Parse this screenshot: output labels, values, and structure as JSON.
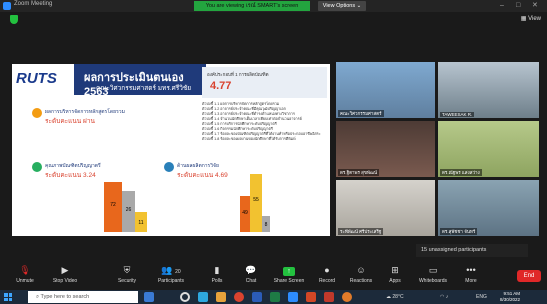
{
  "window": {
    "title": "Zoom Meeting",
    "share_banner": "You are viewing เรณ์ SMART's screen",
    "view_options": "View Options",
    "view_label": "View",
    "controls": [
      "–",
      "□",
      "✕"
    ]
  },
  "slide": {
    "logo": "RUTS",
    "title": "ผลการประเมินตนเอง 2563",
    "subtitle": "คณะวิศวกรรมศาสตร์ มทร.ศรีวิชัย",
    "score_heading": "องค์ประกอบที่ 1 การผลิตบัณฑิต",
    "score_value": "4.77",
    "criteria": [
      "ตัวบ่งชี้ 1.1  ผลการบริหารจัดการหลักสูตรโดยรวม",
      "ตัวบ่งชี้ 1.2  อาจารย์ประจำคณะที่มีคุณวุฒิปริญญาเอก",
      "ตัวบ่งชี้ 1.3  อาจารย์ประจำคณะที่ดำรงตำแหน่งทางวิชาการ",
      "ตัวบ่งชี้ 1.4  จำนวนนักศึกษาเต็มเวลาเทียบเท่าต่อจำนวนอาจารย์",
      "ตัวบ่งชี้ 1.5  การบริการนักศึกษาระดับปริญญาตรี",
      "ตัวบ่งชี้ 1.6  กิจกรรมนักศึกษาระดับปริญญาตรี",
      "ตัวบ่งชี้ 1.7  ร้อยละของบัณฑิตปริญญาตรีที่ได้งานทำหรือประกอบอาชีพอิสระ",
      "ตัวบ่งชี้ 1.8  ร้อยละของผลงานของนักศึกษาที่ได้รับการตีพิมพ์"
    ],
    "section1_label": "ผลการบริหารจัดการหลักสูตรโดยรวม",
    "section1_value": "ระดับคะแนน ผ่าน",
    "section2_label": "คุณภาพบัณฑิตปริญญาตรี",
    "section2_value": "ระดับคะแนน 3.24",
    "section3_label": "ด้านผลผลิตการวิจัย",
    "section3_value": "ระดับคะแนน 4.69",
    "chart_a_values": [
      "72",
      "26",
      "11"
    ],
    "chart_b_values": [
      "55",
      "49",
      "8"
    ]
  },
  "participants": [
    {
      "name": "คณะวิศวกรรมศาสตร์"
    },
    {
      "name": "TAWEESAK R."
    },
    {
      "name": "ดร.ฐิตาพร สุขพัฒน์"
    },
    {
      "name": "ดร.ณัฐพร แสงสว่าง"
    },
    {
      "name": "Suttisak"
    },
    {
      "name": "นายศักดิ์ชัย เพ็ชรหาร"
    },
    {
      "name": "ระพีพัฒน์ ศรีประเสริฐ"
    },
    {
      "name": "ดร.สุพัชชา จันทร์"
    }
  ],
  "unassigned": "15 unassigned participants",
  "toolbar": {
    "unmute": "Unmute",
    "stop_video": "Stop Video",
    "security": "Security",
    "participants": "Participants",
    "participant_count": "20",
    "polls": "Polls",
    "chat": "Chat",
    "share_screen": "Share Screen",
    "record": "Record",
    "reactions": "Reactions",
    "apps": "Apps",
    "whiteboards": "Whiteboards",
    "more": "More",
    "end": "End"
  },
  "taskbar": {
    "search_placeholder": "Type here to search",
    "temperature": "28°C",
    "language": "ENG",
    "time": "9:51 AM",
    "date": "8/30/2022"
  }
}
